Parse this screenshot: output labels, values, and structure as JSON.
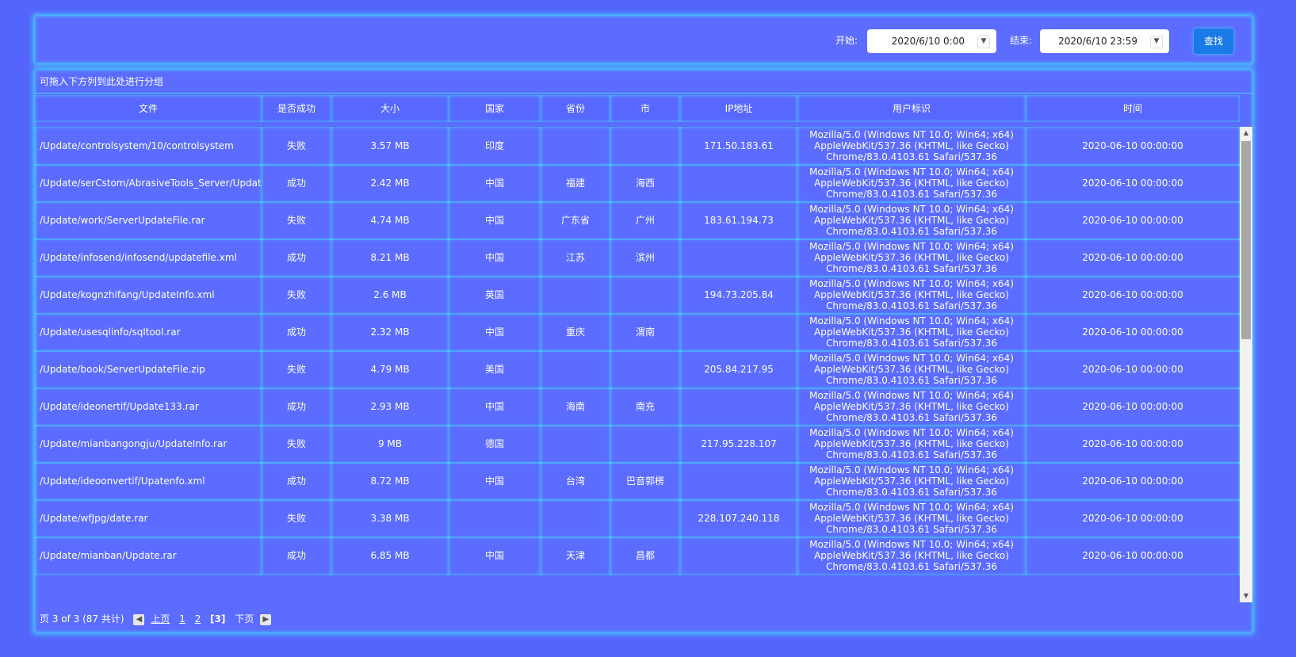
{
  "toolbar": {
    "start_label": "开始:",
    "start_value": "2020/6/10 0:00",
    "end_label": "结束:",
    "end_value": "2020/6/10 23:59",
    "search_label": "查找"
  },
  "grid": {
    "group_panel": "可拖入下方列到此处进行分组",
    "headers": [
      "文件",
      "是否成功",
      "大小",
      "国家",
      "省份",
      "市",
      "IP地址",
      "用户标识",
      "时间"
    ],
    "rows": [
      {
        "file": "/Update/controlsystem/10/controlsystem",
        "ok": "失败",
        "size": "3.57 MB",
        "country": "印度",
        "province": "",
        "city": "",
        "ip": "171.50.183.61",
        "ua1": "Mozilla/5.0 (Windows NT 10.0; Win64; x64)",
        "ua2": "AppleWebKit/537.36 (KHTML, like Gecko)",
        "ua3": "Chrome/83.0.4103.61 Safari/537.36",
        "time": "2020-06-10 00:00:00"
      },
      {
        "file": "/Update/serCstom/AbrasiveTools_Server/UpdateInfo.xml",
        "ok": "成功",
        "size": "2.42 MB",
        "country": "中国",
        "province": "福建",
        "city": "海西",
        "ip": "",
        "ua1": "Mozilla/5.0 (Windows NT 10.0; Win64; x64)",
        "ua2": "AppleWebKit/537.36 (KHTML, like Gecko)",
        "ua3": "Chrome/83.0.4103.61 Safari/537.36",
        "time": "2020-06-10 00:00:00"
      },
      {
        "file": "/Update/work/ServerUpdateFile.rar",
        "ok": "失败",
        "size": "4.74 MB",
        "country": "中国",
        "province": "广东省",
        "city": "广州",
        "ip": "183.61.194.73",
        "ua1": "Mozilla/5.0 (Windows NT 10.0; Win64; x64)",
        "ua2": "AppleWebKit/537.36 (KHTML, like Gecko)",
        "ua3": "Chrome/83.0.4103.61 Safari/537.36",
        "time": "2020-06-10 00:00:00"
      },
      {
        "file": "/Update/infosend/infosend/updatefile.xml",
        "ok": "成功",
        "size": "8.21 MB",
        "country": "中国",
        "province": "江苏",
        "city": "滨州",
        "ip": "",
        "ua1": "Mozilla/5.0 (Windows NT 10.0; Win64; x64)",
        "ua2": "AppleWebKit/537.36 (KHTML, like Gecko)",
        "ua3": "Chrome/83.0.4103.61 Safari/537.36",
        "time": "2020-06-10 00:00:00"
      },
      {
        "file": "/Update/kognzhifang/UpdateInfo.xml",
        "ok": "失败",
        "size": "2.6 MB",
        "country": "英国",
        "province": "",
        "city": "",
        "ip": "194.73.205.84",
        "ua1": "Mozilla/5.0 (Windows NT 10.0; Win64; x64)",
        "ua2": "AppleWebKit/537.36 (KHTML, like Gecko)",
        "ua3": "Chrome/83.0.4103.61 Safari/537.36",
        "time": "2020-06-10 00:00:00"
      },
      {
        "file": "/Update/usesqlinfo/sqltool.rar",
        "ok": "成功",
        "size": "2.32 MB",
        "country": "中国",
        "province": "重庆",
        "city": "渭南",
        "ip": "",
        "ua1": "Mozilla/5.0 (Windows NT 10.0; Win64; x64)",
        "ua2": "AppleWebKit/537.36 (KHTML, like Gecko)",
        "ua3": "Chrome/83.0.4103.61 Safari/537.36",
        "time": "2020-06-10 00:00:00"
      },
      {
        "file": "/Update/book/ServerUpdateFile.zip",
        "ok": "失败",
        "size": "4.79 MB",
        "country": "美国",
        "province": "",
        "city": "",
        "ip": "205.84.217.95",
        "ua1": "Mozilla/5.0 (Windows NT 10.0; Win64; x64)",
        "ua2": "AppleWebKit/537.36 (KHTML, like Gecko)",
        "ua3": "Chrome/83.0.4103.61 Safari/537.36",
        "time": "2020-06-10 00:00:00"
      },
      {
        "file": "/Update/ideonertif/Update133.rar",
        "ok": "成功",
        "size": "2.93 MB",
        "country": "中国",
        "province": "海南",
        "city": "南充",
        "ip": "",
        "ua1": "Mozilla/5.0 (Windows NT 10.0; Win64; x64)",
        "ua2": "AppleWebKit/537.36 (KHTML, like Gecko)",
        "ua3": "Chrome/83.0.4103.61 Safari/537.36",
        "time": "2020-06-10 00:00:00"
      },
      {
        "file": "/Update/mianbangongju/UpdateInfo.rar",
        "ok": "失败",
        "size": "9 MB",
        "country": "德国",
        "province": "",
        "city": "",
        "ip": "217.95.228.107",
        "ua1": "Mozilla/5.0 (Windows NT 10.0; Win64; x64)",
        "ua2": "AppleWebKit/537.36 (KHTML, like Gecko)",
        "ua3": "Chrome/83.0.4103.61 Safari/537.36",
        "time": "2020-06-10 00:00:00"
      },
      {
        "file": "/Update/ideoonvertif/Upatenfo.xml",
        "ok": "成功",
        "size": "8.72 MB",
        "country": "中国",
        "province": "台湾",
        "city": "巴音郭楞",
        "ip": "",
        "ua1": "Mozilla/5.0 (Windows NT 10.0; Win64; x64)",
        "ua2": "AppleWebKit/537.36 (KHTML, like Gecko)",
        "ua3": "Chrome/83.0.4103.61 Safari/537.36",
        "time": "2020-06-10 00:00:00"
      },
      {
        "file": "/Update/wfJpg/date.rar",
        "ok": "失败",
        "size": "3.38 MB",
        "country": "",
        "province": "",
        "city": "",
        "ip": "228.107.240.118",
        "ua1": "Mozilla/5.0 (Windows NT 10.0; Win64; x64)",
        "ua2": "AppleWebKit/537.36 (KHTML, like Gecko)",
        "ua3": "Chrome/83.0.4103.61 Safari/537.36",
        "time": "2020-06-10 00:00:00"
      },
      {
        "file": "/Update/mianban/Update.rar",
        "ok": "成功",
        "size": "6.85 MB",
        "country": "中国",
        "province": "天津",
        "city": "昌都",
        "ip": "",
        "ua1": "Mozilla/5.0 (Windows NT 10.0; Win64; x64)",
        "ua2": "AppleWebKit/537.36 (KHTML, like Gecko)",
        "ua3": "Chrome/83.0.4103.61 Safari/537.36",
        "time": "2020-06-10 00:00:00"
      }
    ]
  },
  "pager": {
    "summary": "页 3 of 3 (87 共计)",
    "prev": "上页",
    "page1": "1",
    "page2": "2",
    "current": "[3]",
    "next": "下页"
  }
}
